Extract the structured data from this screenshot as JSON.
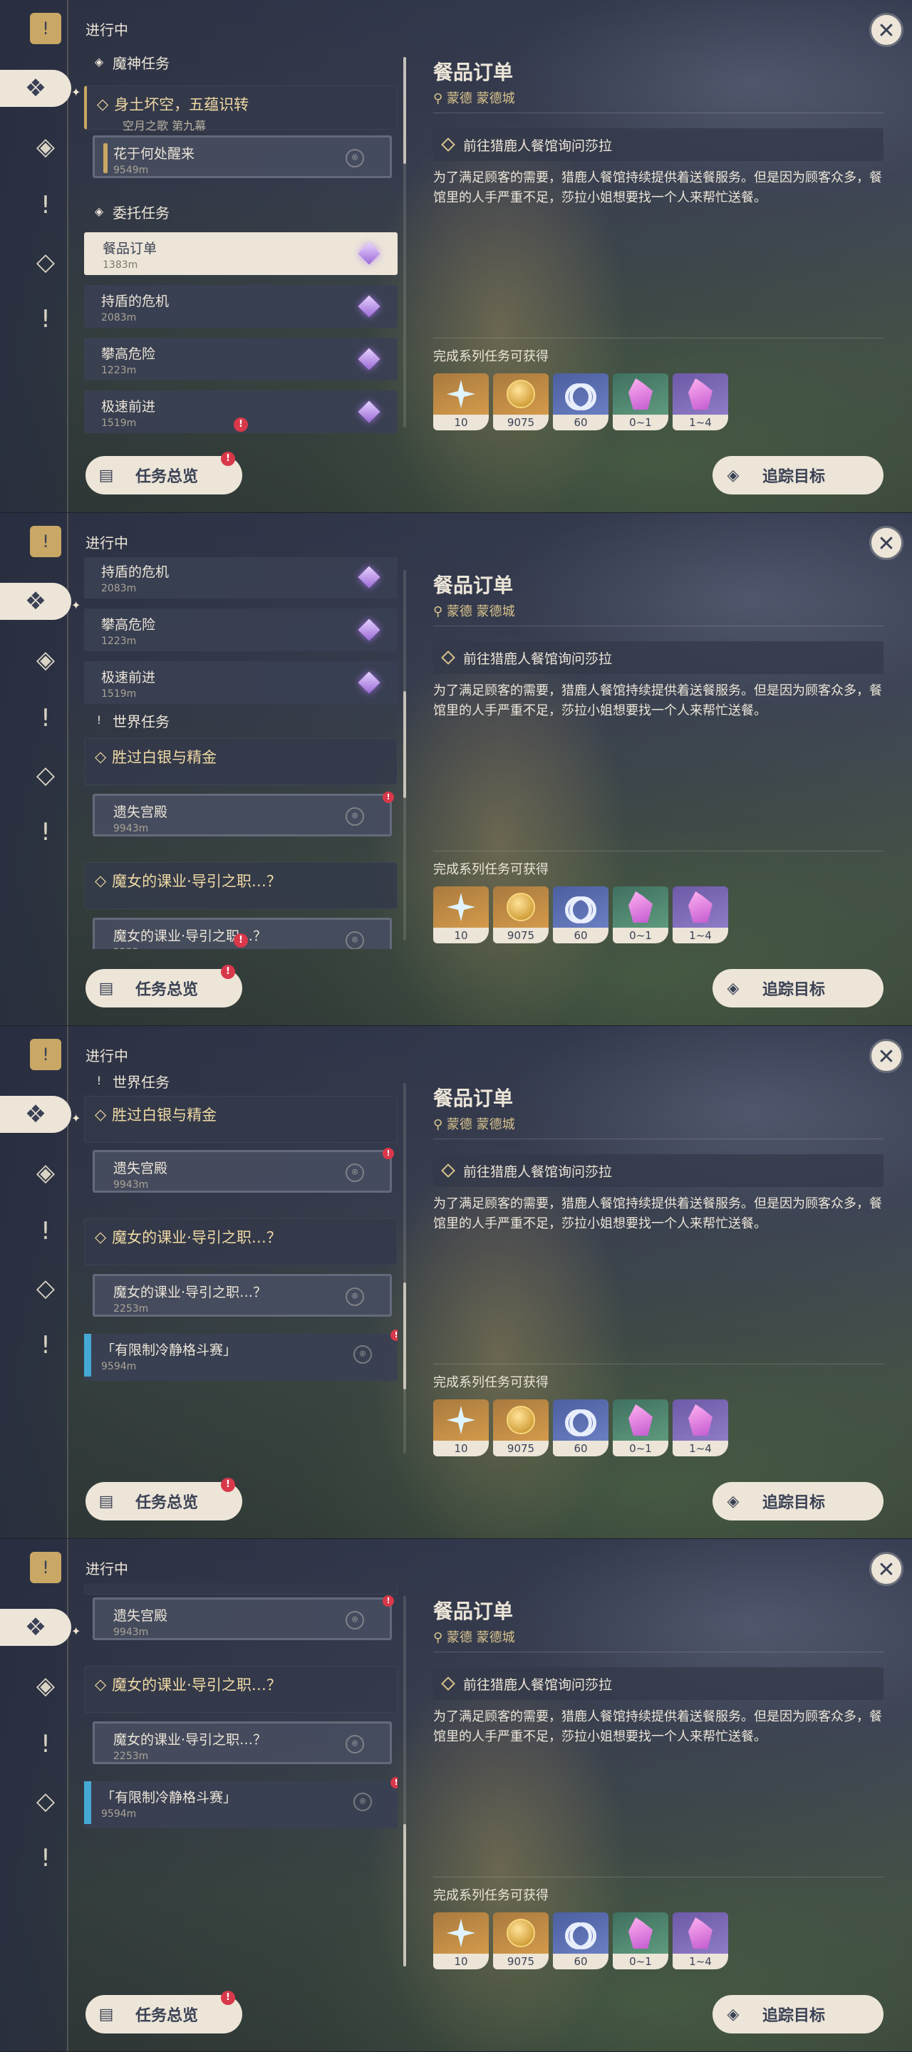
{
  "status_label": "进行中",
  "sections": {
    "archon": "魔神任务",
    "commission": "委托任务",
    "world": "世界任务"
  },
  "quests": {
    "archon_chapter": {
      "title": "身土坏空，五蕴识转",
      "subtitle": "空月之歌 第九幕"
    },
    "archon_sub": {
      "title": "花于何处醒来",
      "distance": "9549m"
    },
    "order": {
      "title": "餐品订单",
      "distance": "1383m"
    },
    "shield": {
      "title": "持盾的危机",
      "distance": "2083m"
    },
    "climb": {
      "title": "攀高危险",
      "distance": "1223m"
    },
    "speed": {
      "title": "极速前进",
      "distance": "1519m"
    },
    "silver": {
      "title": "胜过白银与精金"
    },
    "palace": {
      "title": "遗失宫殿",
      "distance": "9943m"
    },
    "witch": {
      "title": "魔女的课业·导引之职…？"
    },
    "witch_sub": {
      "title": "魔女的课业·导引之职…？",
      "distance": "2253m"
    },
    "fight": {
      "title": "「有限制冷静格斗赛」",
      "distance": "9594m"
    }
  },
  "buttons": {
    "overview": "任务总览",
    "track": "追踪目标"
  },
  "detail": {
    "title": "餐品订单",
    "location": "蒙德 蒙德城",
    "objective": "前往猎鹿人餐馆询问莎拉",
    "description": "为了满足顾客的需要，猎鹿人餐馆持续提供着送餐服务。但是因为顾客众多，餐馆里的人手严重不足，莎拉小姐想要找一个人来帮忙送餐。",
    "rewards_label": "完成系列任务可获得",
    "rewards": [
      {
        "icon": "primogem-icon",
        "count": "10"
      },
      {
        "icon": "mora-icon",
        "count": "9075"
      },
      {
        "icon": "adventure-exp-icon",
        "count": "60"
      },
      {
        "icon": "crystal-chunk-icon",
        "count": "0~1"
      },
      {
        "icon": "fine-enhancement-ore-icon",
        "count": "1~4"
      }
    ]
  },
  "icons": {
    "close": "close-icon",
    "quest_book": "quest-book-icon",
    "alert": "!"
  }
}
